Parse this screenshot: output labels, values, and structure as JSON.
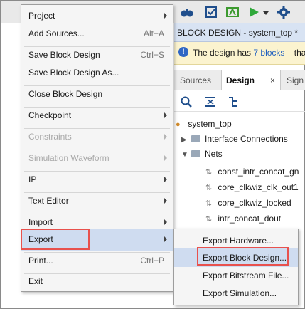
{
  "window": {
    "block_design_title": "BLOCK DESIGN - system_top *",
    "info_prefix": "The design has",
    "info_link": "7 blocks",
    "info_suffix": "tha",
    "tabs": [
      {
        "label": "Sources"
      },
      {
        "label": "Design"
      },
      {
        "label": "Sign"
      }
    ],
    "tab_close": "×",
    "tree": {
      "root": "system_top",
      "interface_connections": "Interface Connections",
      "nets": "Nets",
      "net_items": [
        "const_intr_concat_gn",
        "core_clkwiz_clk_out1",
        "core_clkwiz_locked",
        "intr_concat_dout"
      ]
    }
  },
  "file_menu": {
    "items": [
      {
        "label": "Project",
        "shortcut": "",
        "submenu": true,
        "enabled": true
      },
      {
        "label": "Add Sources...",
        "shortcut": "Alt+A",
        "submenu": false,
        "enabled": true
      },
      {
        "label": "Save Block Design",
        "shortcut": "Ctrl+S",
        "submenu": false,
        "enabled": true
      },
      {
        "label": "Save Block Design As...",
        "shortcut": "",
        "submenu": false,
        "enabled": true
      },
      {
        "label": "Close Block Design",
        "shortcut": "",
        "submenu": false,
        "enabled": true
      },
      {
        "label": "Checkpoint",
        "shortcut": "",
        "submenu": true,
        "enabled": true
      },
      {
        "label": "Constraints",
        "shortcut": "",
        "submenu": true,
        "enabled": false
      },
      {
        "label": "Simulation Waveform",
        "shortcut": "",
        "submenu": true,
        "enabled": false
      },
      {
        "label": "IP",
        "shortcut": "",
        "submenu": true,
        "enabled": true
      },
      {
        "label": "Text Editor",
        "shortcut": "",
        "submenu": true,
        "enabled": true
      },
      {
        "label": "Import",
        "shortcut": "",
        "submenu": true,
        "enabled": true
      },
      {
        "label": "Export",
        "shortcut": "",
        "submenu": true,
        "enabled": true,
        "highlighted": true
      },
      {
        "label": "Print...",
        "shortcut": "Ctrl+P",
        "submenu": false,
        "enabled": true
      },
      {
        "label": "Exit",
        "shortcut": "",
        "submenu": false,
        "enabled": true
      }
    ]
  },
  "export_submenu": {
    "items": [
      {
        "label": "Export Hardware..."
      },
      {
        "label": "Export Block Design...",
        "highlighted": true
      },
      {
        "label": "Export Bitstream File..."
      },
      {
        "label": "Export Simulation..."
      }
    ]
  },
  "colors": {
    "highlight": "#cfdcf0",
    "callout": "#e8514d",
    "header_blue": "#d8e3f3",
    "info_yellow": "#fbf3cf",
    "link": "#1f5fbf"
  }
}
